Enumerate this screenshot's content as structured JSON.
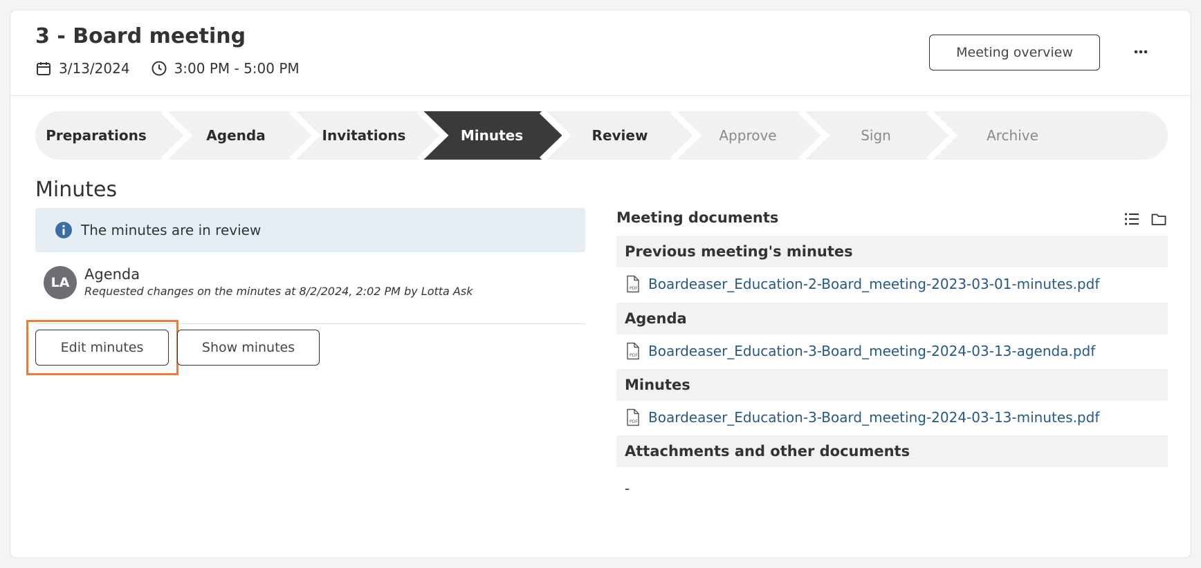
{
  "header": {
    "title": "3 - Board meeting",
    "date": "3/13/2024",
    "time": "3:00 PM - 5:00 PM",
    "overview_label": "Meeting overview",
    "more_label": "···"
  },
  "steps": [
    {
      "label": "Preparations",
      "state": "done"
    },
    {
      "label": "Agenda",
      "state": "done"
    },
    {
      "label": "Invitations",
      "state": "done"
    },
    {
      "label": "Minutes",
      "state": "active"
    },
    {
      "label": "Review",
      "state": "done"
    },
    {
      "label": "Approve",
      "state": "disabled"
    },
    {
      "label": "Sign",
      "state": "disabled"
    },
    {
      "label": "Archive",
      "state": "disabled"
    }
  ],
  "section": {
    "title": "Minutes",
    "info": "The minutes are in review",
    "entry": {
      "initials": "LA",
      "title": "Agenda",
      "subtitle": "Requested changes on the minutes at 8/2/2024, 2:02 PM by Lotta Ask"
    },
    "edit_label": "Edit minutes",
    "show_label": "Show minutes"
  },
  "documents": {
    "title": "Meeting documents",
    "groups": [
      {
        "label": "Previous meeting's minutes",
        "file": "Boardeaser_Education-2-Board_meeting-2023-03-01-minutes.pdf"
      },
      {
        "label": "Agenda",
        "file": "Boardeaser_Education-3-Board_meeting-2024-03-13-agenda.pdf"
      },
      {
        "label": "Minutes",
        "file": "Boardeaser_Education-3-Board_meeting-2024-03-13-minutes.pdf"
      },
      {
        "label": "Attachments and other documents",
        "file": null
      }
    ],
    "empty": "-"
  },
  "colors": {
    "accent_highlight": "#ed7a35",
    "active_step": "#3a3a3a",
    "link": "#25588a",
    "info_bg": "#e6eef5",
    "info_icon": "#3b6fa3"
  }
}
